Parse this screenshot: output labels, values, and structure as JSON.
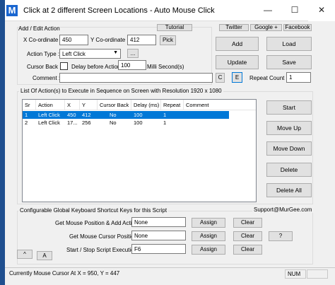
{
  "window": {
    "logo_letter": "M",
    "title": "Click at 2 different Screen Locations - Auto Mouse Click",
    "minimize": "—",
    "maximize": "☐",
    "close": "✕"
  },
  "add_edit": {
    "group_label": "Add / Edit Action",
    "tutorial_label": "Tutorial",
    "x_label": "X Co-ordinate :",
    "x_value": "450",
    "y_label": "Y Co-ordinate :",
    "y_value": "412",
    "pick_label": "Pick",
    "action_type_label": "Action Type :",
    "action_type_value": "Left Click",
    "action_type_more": "...",
    "cursor_back_label": "Cursor Back :",
    "delay_label": "Delay before Action :",
    "delay_value": "100",
    "delay_unit": "Milli Second(s)",
    "comment_label": "Comment :",
    "comment_value": "",
    "c_label": "C",
    "e_label": "E",
    "repeat_label": "Repeat Count :",
    "repeat_value": "1"
  },
  "social": {
    "twitter": "Twitter",
    "google": "Google +",
    "facebook": "Facebook"
  },
  "action_buttons": {
    "add": "Add",
    "load": "Load",
    "update": "Update",
    "save": "Save"
  },
  "list": {
    "group_label": "List Of Action(s) to Execute in Sequence on Screen with Resolution 1920 x 1080",
    "columns": [
      "Sr",
      "Action",
      "X",
      "Y",
      "Cursor Back",
      "Delay (ms)",
      "Repeat",
      "Comment"
    ],
    "rows": [
      [
        "1",
        "Left Click",
        "450",
        "412",
        "No",
        "100",
        "1",
        ""
      ],
      [
        "2",
        "Left Click",
        "17...",
        "256",
        "No",
        "100",
        "1",
        ""
      ]
    ],
    "selected_row": 0
  },
  "side_buttons": {
    "start": "Start",
    "move_up": "Move Up",
    "move_down": "Move Down",
    "delete": "Delete",
    "delete_all": "Delete All"
  },
  "shortcuts": {
    "group_label": "Configurable Global Keyboard Shortcut Keys for this Script",
    "support": "Support@MurGee.com",
    "rows": [
      {
        "label": "Get Mouse Position & Add Action :",
        "value": "None",
        "assign": "Assign",
        "clear": "Clear"
      },
      {
        "label": "Get Mouse Cursor Position :",
        "value": "None",
        "assign": "Assign",
        "clear": "Clear"
      },
      {
        "label": "Start / Stop Script Execution :",
        "value": "F6",
        "assign": "Assign",
        "clear": "Clear"
      }
    ],
    "help": "?",
    "up_arrow": "^",
    "a_label": "A"
  },
  "status": {
    "text": "Currently Mouse Cursor At X = 950, Y = 447",
    "num": "NUM"
  }
}
